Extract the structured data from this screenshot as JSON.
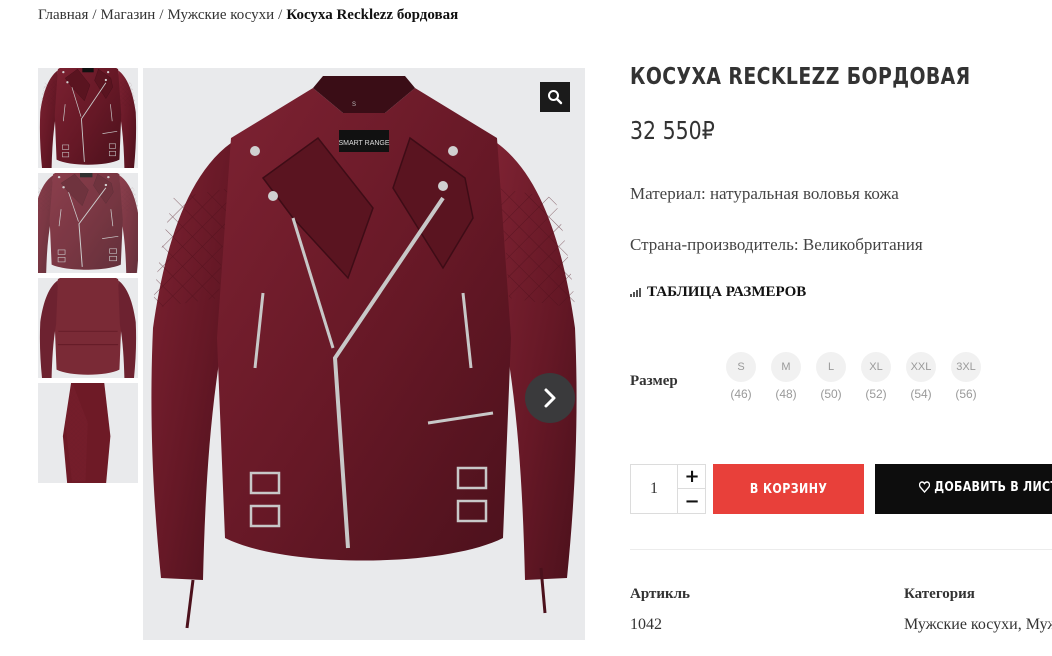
{
  "breadcrumb": {
    "items": [
      "Главная",
      "Магазин",
      "Мужские косухи"
    ],
    "separator": "/",
    "current": "Косуха Recklezz бордовая"
  },
  "gallery": {
    "thumbnails": [
      "thumbnail-front",
      "thumbnail-front-angle",
      "thumbnail-back",
      "thumbnail-side"
    ],
    "zoom_icon": "search-icon",
    "next_icon": "chevron-right-icon",
    "label_text": "SMART RANGE",
    "tag_text": "S"
  },
  "product": {
    "title": "КОСУХА RECKLEZZ БОРДОВАЯ",
    "price": "32 550₽",
    "material": "Материал: натуральная воловья кожа",
    "country": "Страна-производитель: Великобритания",
    "size_table_label": "ТАБЛИЦА РАЗМЕРОВ",
    "size_label": "Размер",
    "sizes": [
      {
        "label": "S",
        "num": "(46)"
      },
      {
        "label": "M",
        "num": "(48)"
      },
      {
        "label": "L",
        "num": "(50)"
      },
      {
        "label": "XL",
        "num": "(52)"
      },
      {
        "label": "XXL",
        "num": "(54)"
      },
      {
        "label": "3XL",
        "num": "(56)"
      }
    ]
  },
  "cart": {
    "quantity": "1",
    "plus": "+",
    "minus": "−",
    "add_to_cart": "В КОРЗИНУ",
    "wishlist": "ДОБАВИТЬ В ЛИСТ Ж"
  },
  "meta": {
    "sku_label": "Артикль",
    "sku_value": "1042",
    "category_label": "Категория",
    "category_value": "Мужские косухи, Муж"
  },
  "colors": {
    "accent": "#e8403a",
    "dark": "#0d0d0d",
    "jacket": "#6e1a26"
  }
}
